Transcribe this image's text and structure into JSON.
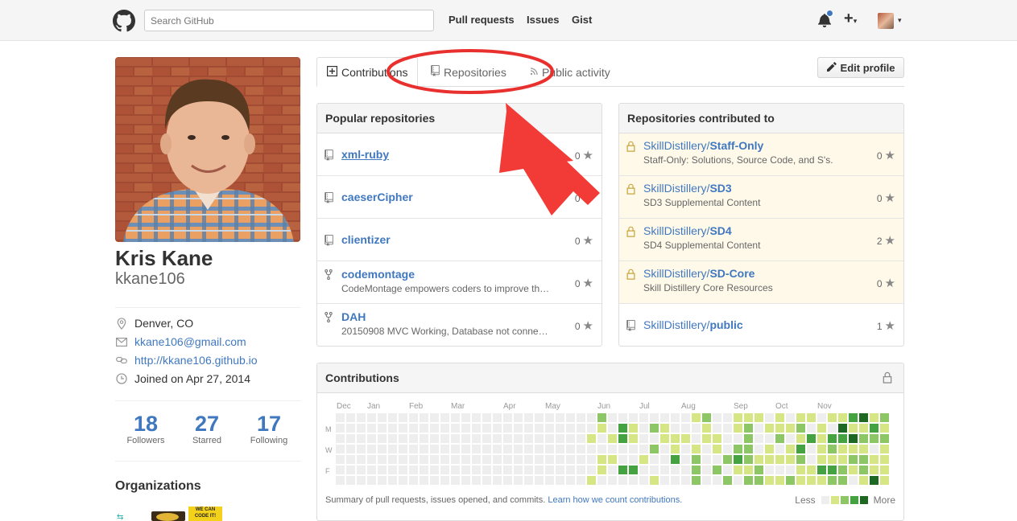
{
  "header": {
    "search_placeholder": "Search GitHub",
    "nav": [
      "Pull requests",
      "Issues",
      "Gist"
    ],
    "plus": "+"
  },
  "profile": {
    "name": "Kris Kane",
    "username": "kkane106",
    "location": "Denver, CO",
    "email": "kkane106@gmail.com",
    "website": "http://kkane106.github.io",
    "joined": "Joined on Apr 27, 2014",
    "stats": [
      {
        "num": "18",
        "label": "Followers"
      },
      {
        "num": "27",
        "label": "Starred"
      },
      {
        "num": "17",
        "label": "Following"
      }
    ],
    "orgs_title": "Organizations",
    "org_badge": "WE CAN CODE IT!"
  },
  "tabs": {
    "contributions": "Contributions",
    "repositories": "Repositories",
    "public_activity": "Public activity",
    "edit_profile": "Edit profile"
  },
  "popular": {
    "title": "Popular repositories",
    "items": [
      {
        "name": "xml-ruby",
        "desc": "",
        "stars": "0",
        "fork": false
      },
      {
        "name": "caeserCipher",
        "desc": "",
        "stars": "0",
        "fork": false
      },
      {
        "name": "clientizer",
        "desc": "",
        "stars": "0",
        "fork": false
      },
      {
        "name": "codemontage",
        "desc": "CodeMontage empowers coders to improve th…",
        "stars": "0",
        "fork": true
      },
      {
        "name": "DAH",
        "desc": "20150908 MVC Working, Database not conne…",
        "stars": "0",
        "fork": true
      }
    ]
  },
  "contributed": {
    "title": "Repositories contributed to",
    "owner": "SkillDistillery/",
    "items": [
      {
        "repo": "Staff-Only",
        "desc": "Staff-Only: Solutions, Source Code, and S's.",
        "stars": "0",
        "private": true
      },
      {
        "repo": "SD3",
        "desc": "SD3 Supplemental Content",
        "stars": "0",
        "private": true
      },
      {
        "repo": "SD4",
        "desc": "SD4 Supplemental Content",
        "stars": "2",
        "private": true
      },
      {
        "repo": "SD-Core",
        "desc": "Skill Distillery Core Resources",
        "stars": "0",
        "private": true
      },
      {
        "repo": "public",
        "desc": "",
        "stars": "1",
        "private": false
      }
    ]
  },
  "contributions": {
    "title": "Contributions",
    "months": [
      "Dec",
      "Jan",
      "Feb",
      "Mar",
      "Apr",
      "May",
      "Jun",
      "Jul",
      "Aug",
      "Sep",
      "Oct",
      "Nov"
    ],
    "days": [
      "M",
      "W",
      "F"
    ],
    "summary": "Summary of pull requests, issues opened, and commits.",
    "learn_link": "Learn how we count contributions.",
    "less": "Less",
    "more": "More",
    "colors": [
      "#eeeeee",
      "#d6e685",
      "#8cc665",
      "#44a340",
      "#1e6823"
    ]
  }
}
